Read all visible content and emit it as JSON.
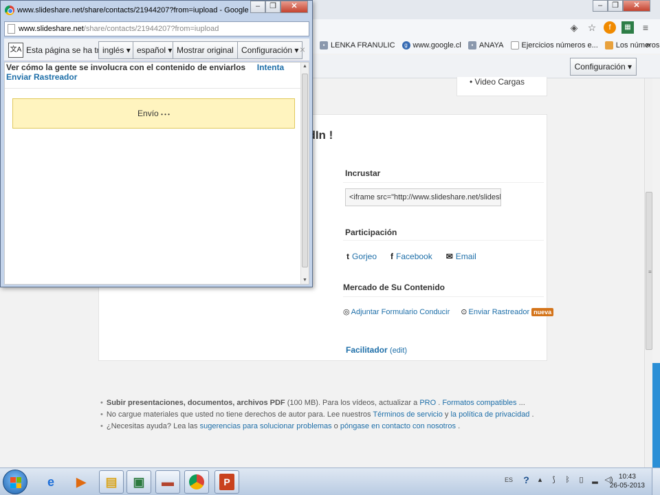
{
  "popup": {
    "title": "www.slideshare.net/share/contacts/21944207?from=iupload - Google Chrome",
    "address_domain": "www.slideshare.net",
    "address_rest": "/share/contacts/21944207?from=iupload",
    "translate": {
      "message": "Esta página se ha tr...",
      "from_lang": "inglés",
      "to_lang": "español",
      "show_original": "Mostrar original",
      "config": "Configuración",
      "close": "×"
    },
    "heading_text": "Ver cómo la gente se involucra con el contenido de enviarlos",
    "heading_link": "Intenta Enviar Rastreador",
    "status_text": "Envío",
    "status_dots": "• • •"
  },
  "background": {
    "bookmarks": [
      {
        "label": "LENKA FRANULIC",
        "icon": "bookmark-icon"
      },
      {
        "label": "www.google.cl",
        "icon": "google-icon"
      },
      {
        "label": "ANAYA",
        "icon": "bookmark-icon"
      },
      {
        "label": "Ejercicios números e...",
        "icon": "page-icon"
      },
      {
        "label": "Los números entero...",
        "icon": "page-icon"
      }
    ],
    "bookmarks_more": "»",
    "config_button": "Configuración",
    "page": {
      "top_list_item": "• Video Cargas",
      "heading_partial": "edIn !",
      "embed_label": "Incrustar",
      "embed_code": "<iframe src=\"http://www.slideshare.net/slideshow/emb",
      "share_label": "Participación",
      "share_links": [
        "Gorjeo",
        "Facebook",
        "Email"
      ],
      "market_label": "Mercado de Su Contenido",
      "market_link_1": "Adjuntar Formulario Conducir",
      "market_link_2": "Enviar Rastreador",
      "market_badge": "nueva",
      "facilitator": "Facilitador",
      "facilitator_edit": "(edit)",
      "footer": {
        "line1_a": "Subir presentaciones, documentos, archivos PDF",
        "line1_b": " (100 MB). Para los vídeos, actualizar a ",
        "line1_pro": "PRO",
        "line1_c": " . ",
        "line1_formats": "Formatos compatibles",
        "line1_d": " ...",
        "line2_a": "No cargue materiales que usted no tiene derechos de autor para. Lee nuestros ",
        "line2_terms": "Términos de servicio",
        "line2_b": " y ",
        "line2_privacy": "la política de privacidad",
        "line2_c": " .",
        "line3_a": "¿Necesitas ayuda? Lea las ",
        "line3_suggest": "sugerencias para solucionar problemas",
        "line3_b": " o ",
        "line3_contact": "póngase en contacto con nosotros",
        "line3_c": " ."
      }
    }
  },
  "taskbar": {
    "language": "ES",
    "time": "10:43",
    "date": "26-05-2013"
  },
  "colors": {
    "link": "#1d6ea8",
    "status_box_bg": "#fff4bf",
    "badge": "#d4741a",
    "taskbar_edge": "#2b8fd6"
  }
}
